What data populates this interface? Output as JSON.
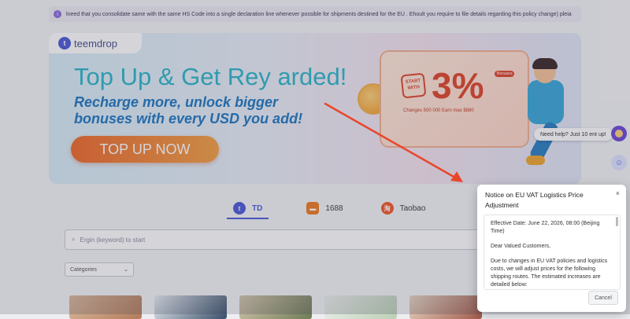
{
  "announcement": {
    "icon": "info-icon",
    "text": "lneed that you consolidate same with the same HS Code into a single declaration line whenever possible for shipments destined for the EU . Ehoult you require to file details regarding this policy change) pleia"
  },
  "banner": {
    "brand_name": "teemdrop",
    "headline": "Top Up & Get Rey arded!",
    "subheadline": "Recharge more, unlock bigger bonuses with every USD you add!",
    "cta_label": "TOP UP NOW",
    "coupon_start": "START WITH",
    "coupon_percent": "3%",
    "coupon_tag": "Bonuses",
    "coupon_detail": "Changes 500 000 Earn max $880"
  },
  "tabs": [
    {
      "label": "TD",
      "icon": "td-icon",
      "color": "#4f5ad6"
    },
    {
      "label": "1688",
      "icon": "1688-icon",
      "color": "#f07b20"
    },
    {
      "label": "Taobao",
      "icon": "taobao-icon",
      "color": "#f35a2a"
    }
  ],
  "search": {
    "placeholder": "Ergin (keyword) to start"
  },
  "category_select": {
    "value": "Categories"
  },
  "help": {
    "text": "Need help? Just 10 ent up!"
  },
  "modal": {
    "title": "Notice on EU VAT Logistics Price Adjustment",
    "close": "×",
    "effective_date": "Effective Date: June 22, 2026, 08:00 (Beijing Time)",
    "greeting": "Dear Valued Customers,",
    "body": "Due to changes in EU VAT policies and logistics costs, we will adjust prices for the following shipping routes. The estimated increases are detailed below:",
    "cancel_label": "Cancel"
  },
  "colors": {
    "accent": "#4f5ad6",
    "cta": "#ef6a2b",
    "arrow": "#e8472b"
  }
}
